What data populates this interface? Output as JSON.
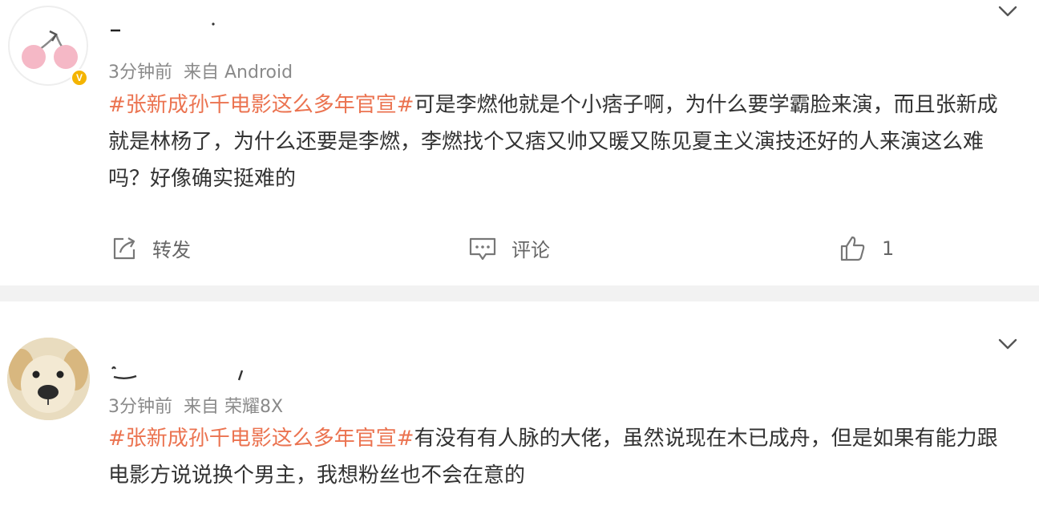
{
  "posts": [
    {
      "time": "3分钟前",
      "source": "来自 Android",
      "hashtag": "#张新成孙千电影这么多年官宣#",
      "text": "可是李燃他就是个小痞子啊，为什么要学霸脸来演，而且张新成就是林杨了，为什么还要是李燃，李燃找个又痞又帅又暖又陈见夏主义演技还好的人来演这么难吗？好像确实挺难的",
      "verified_badge": "V",
      "actions": {
        "repost_label": "转发",
        "comment_label": "评论",
        "like_count": "1"
      },
      "avatar_icon": "cherry-avatar-icon"
    },
    {
      "time": "3分钟前",
      "source": "来自 荣耀8X",
      "hashtag": "#张新成孙千电影这么多年官宣#",
      "text": "有没有有人脉的大佬，虽然说现在木已成舟，但是如果有能力跟电影方说说换个男主，我想粉丝也不会在意的",
      "avatar_icon": "dog-avatar-icon"
    }
  ],
  "colors": {
    "hashtag": "#eb7350",
    "meta": "#8a8a8a",
    "badge": "#f4b400",
    "separator": "#f2f2f2"
  }
}
